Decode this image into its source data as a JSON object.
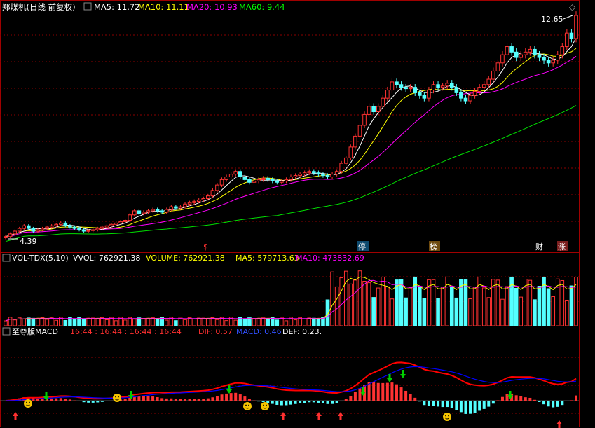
{
  "header": {
    "title": "郑煤机(日线 前复权)",
    "ma5_label": "MA5: 11.72",
    "ma10_label": "MA10: 11.11",
    "ma20_label": "MA20: 10.93",
    "ma60_label": "MA60: 9.44"
  },
  "price_panel": {
    "high_label": "12.65",
    "low_label": "4.39",
    "event_markers": [
      "$",
      "停",
      "榜",
      "财",
      "涨"
    ]
  },
  "vol_panel": {
    "title": "VOL-TDX(5,10)",
    "vvol_label": "VVOL: 762921.38",
    "volume_label": "VOLUME: 762921.38",
    "ma5_label": "MA5: 579713.63",
    "ma10_label": "MA10: 473832.69"
  },
  "macd_panel": {
    "title": "至尊版MACD",
    "time_label": "16:44 : 16:44 : 16:44 : 16:44",
    "dif_label": "DIF: 0.57",
    "macd_label": "MACD: 0.46",
    "def_label": "DEF: 0.23."
  },
  "colors": {
    "up": "#ff3232",
    "down": "#54ffff",
    "ma5": "#ffffff",
    "ma10": "#ffff00",
    "ma20": "#ff00ff",
    "ma60": "#00e000",
    "dif": "#ff0000",
    "dea": "#0000ff",
    "grid": "#8b0000"
  },
  "chart_data": [
    {
      "type": "candlestick",
      "title": "郑煤机(日线 前复权)",
      "closes": [
        4.5,
        4.6,
        4.7,
        4.8,
        4.9,
        4.8,
        4.7,
        4.75,
        4.8,
        4.85,
        4.9,
        4.95,
        5.0,
        4.9,
        4.85,
        4.8,
        4.75,
        4.7,
        4.72,
        4.75,
        4.8,
        4.85,
        4.9,
        4.95,
        5.0,
        5.05,
        5.1,
        5.3,
        5.45,
        5.35,
        5.4,
        5.45,
        5.5,
        5.45,
        5.4,
        5.5,
        5.6,
        5.55,
        5.6,
        5.7,
        5.75,
        5.8,
        5.85,
        5.9,
        6.0,
        6.2,
        6.4,
        6.6,
        6.7,
        6.8,
        6.9,
        6.7,
        6.6,
        6.5,
        6.55,
        6.6,
        6.65,
        6.6,
        6.55,
        6.5,
        6.55,
        6.6,
        6.7,
        6.75,
        6.8,
        6.85,
        6.9,
        6.85,
        6.8,
        6.75,
        6.7,
        6.8,
        6.9,
        7.2,
        7.4,
        7.8,
        8.2,
        8.6,
        9.0,
        9.3,
        9.1,
        9.3,
        9.6,
        9.9,
        10.2,
        10.1,
        10.0,
        9.95,
        10.0,
        9.8,
        9.7,
        9.6,
        9.9,
        10.1,
        10.0,
        10.05,
        10.15,
        10.0,
        9.8,
        9.6,
        9.5,
        9.7,
        9.85,
        10.0,
        10.1,
        10.3,
        10.6,
        10.9,
        11.2,
        11.5,
        11.3,
        11.1,
        11.2,
        11.3,
        11.4,
        11.2,
        11.1,
        11.0,
        10.9,
        11.0,
        11.2,
        11.5,
        12.0,
        11.8,
        12.65
      ],
      "low": 4.39,
      "high": 12.65,
      "ma5": 11.72,
      "ma10": 11.11,
      "ma20": 10.93,
      "ma60": 9.44
    },
    {
      "type": "bar",
      "title": "VOL-TDX(5,10)",
      "volume_last": 762921.38,
      "ma5_last": 579713.63,
      "ma10_last": 473832.69
    },
    {
      "type": "bar",
      "title": "至尊版MACD",
      "dif_last": 0.57,
      "macd_last": 0.46,
      "def_last": 0.23
    }
  ]
}
